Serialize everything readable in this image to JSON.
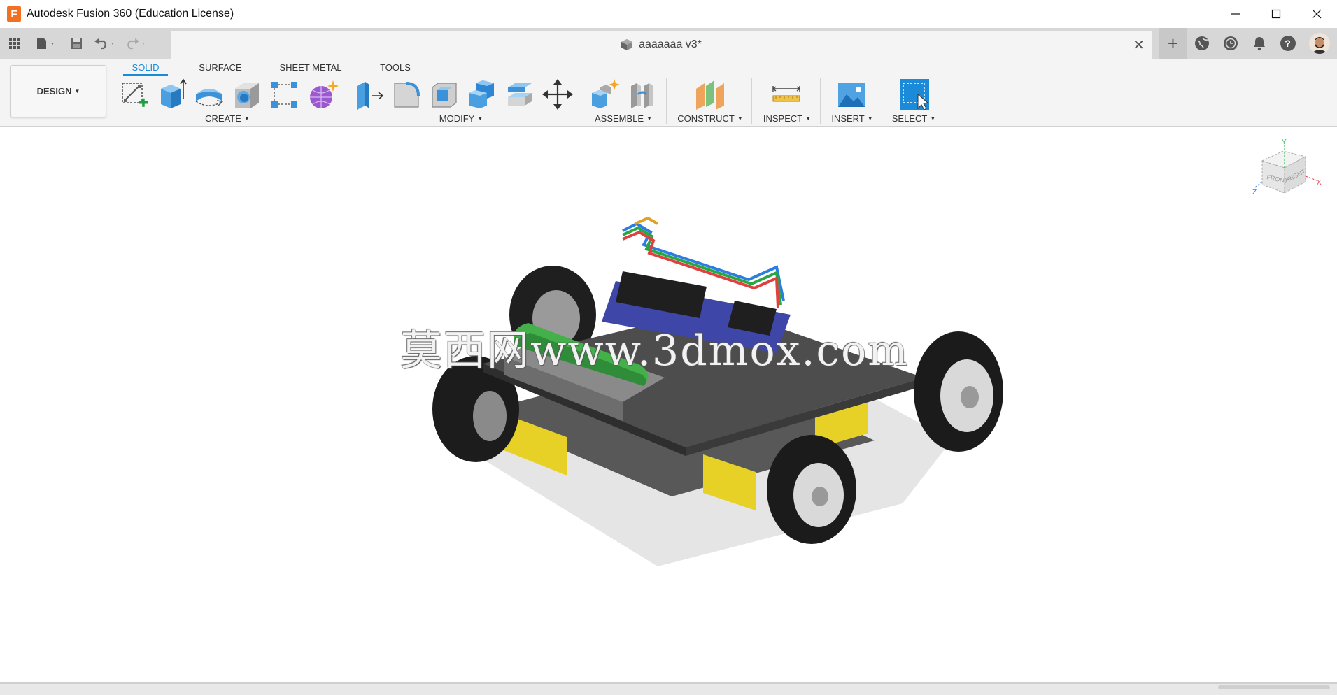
{
  "window": {
    "title": "Autodesk Fusion 360 (Education License)",
    "logo_letter": "F",
    "minimize_icon": "minimize-icon",
    "maximize_icon": "maximize-icon",
    "close_icon": "close-icon"
  },
  "quick_access": {
    "data_panel_icon": "grid-icon",
    "file_icon": "file-icon",
    "save_icon": "save-icon",
    "undo_icon": "undo-icon",
    "redo_icon": "redo-icon"
  },
  "document_tab": {
    "title": "aaaaaaa v3*",
    "close_glyph": "✕"
  },
  "top_right": {
    "new_tab_glyph": "+",
    "icons": [
      "globe-icon",
      "clock-icon",
      "bell-icon",
      "help-icon",
      "avatar"
    ]
  },
  "ribbon": {
    "workspace": "DESIGN",
    "tabs": [
      {
        "label": "SOLID",
        "active": true
      },
      {
        "label": "SURFACE",
        "active": false
      },
      {
        "label": "SHEET METAL",
        "active": false
      },
      {
        "label": "TOOLS",
        "active": false
      }
    ],
    "groups": [
      {
        "label": "CREATE"
      },
      {
        "label": "MODIFY"
      },
      {
        "label": "ASSEMBLE"
      },
      {
        "label": "CONSTRUCT"
      },
      {
        "label": "INSPECT"
      },
      {
        "label": "INSERT"
      },
      {
        "label": "SELECT"
      }
    ],
    "tools": {
      "create": [
        "create-sketch-icon",
        "extrude-icon",
        "revolve-icon",
        "hole-icon",
        "rectangular-pattern-icon",
        "create-form-icon"
      ],
      "modify": [
        "press-pull-icon",
        "fillet-icon",
        "shell-icon",
        "combine-icon",
        "offset-face-icon",
        "move-icon"
      ],
      "assemble": [
        "new-component-icon",
        "joint-icon"
      ],
      "construct": [
        "offset-plane-icon"
      ],
      "inspect": [
        "measure-icon"
      ],
      "insert": [
        "insert-image-icon"
      ],
      "select": [
        "select-icon"
      ]
    },
    "accent_color": "#1b8ad8"
  },
  "viewcube": {
    "faces": [
      "FRONT",
      "RIGHT"
    ],
    "axes": [
      "Y",
      "X",
      "Z"
    ]
  },
  "watermark": "莫西网www.3dmox.com"
}
